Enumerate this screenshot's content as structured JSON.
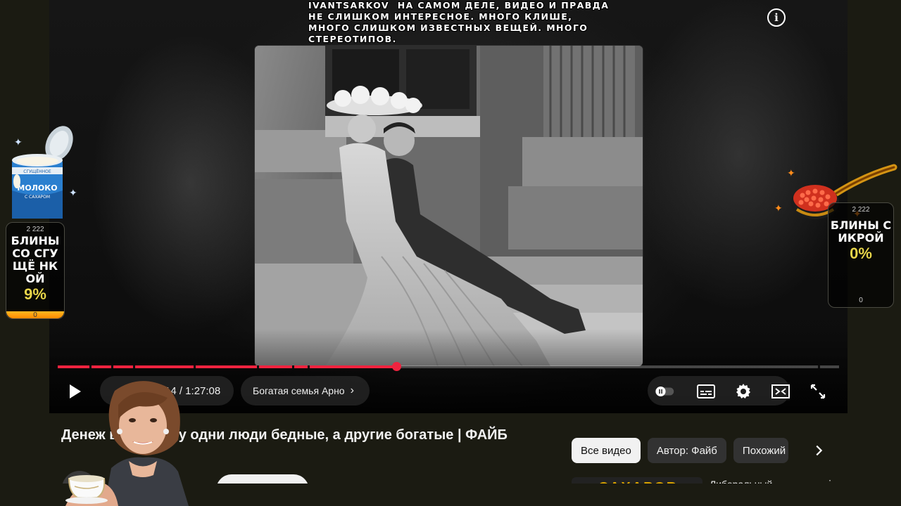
{
  "chat_message": {
    "user": "ivantsarkov",
    "text": "на самом деле, видео и правда не слишком интересное. много клише, много слишком известных вещей. много стереотипов."
  },
  "player": {
    "time_display": "14 / 1:27:08",
    "chapter": "Богатая семья Арно",
    "progress": 0.433,
    "icons": {
      "info": "info-icon",
      "play": "play-icon",
      "autoplay": "autoplay-toggle-icon",
      "subtitles": "subtitles-icon",
      "settings": "gear-icon",
      "miniplayer": "miniplayer-icon",
      "fullscreen": "fullscreen-icon"
    }
  },
  "video": {
    "title": "Денеж     во. Почему одни люди бедные, а другие богатые | ФАЙБ"
  },
  "chips": [
    "Все видео",
    "Автор: Файб",
    "Похожий"
  ],
  "side_video": {
    "title": "Либеральный",
    "thumb_text": "САХАРОВ"
  },
  "widgets": {
    "left": {
      "count": "2 222",
      "title": "БЛИНЫ СО СГУЩЁ НКОЙ",
      "percent": "9%",
      "bottom": "0",
      "image_text": "МОЛОКО",
      "image_subtext": "СГУЩЁННОЕ",
      "image_subtext2": "С САХАРОМ"
    },
    "right": {
      "count": "2 222",
      "title": "БЛИНЫ С ИКРОЙ",
      "percent": "0%",
      "bottom": "0"
    }
  },
  "colors": {
    "progress_played": "#f0233f",
    "widget_percent": "#e8d64a",
    "chip_active_bg": "#f1f1f1"
  }
}
